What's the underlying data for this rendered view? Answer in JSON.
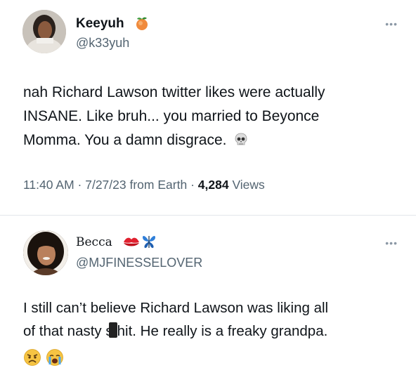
{
  "tweets": [
    {
      "display_name": "Keeyuh",
      "handle": "@k33yuh",
      "text_lines": [
        "nah Richard Lawson twitter likes were actually",
        "INSANE. Like bruh... you married to Beyonce",
        "Momma. You a damn disgrace."
      ],
      "time": "11:40 AM",
      "date": "7/27/23",
      "source": "from Earth",
      "views_count": "4,284",
      "views_label": "Views",
      "name_icon": "peach-icon",
      "trailing_emoji": "skull-icon"
    },
    {
      "display_name": "Becca",
      "handle": "@MJFINESSELOVER",
      "text_line1": "I still can’t believe Richard Lawson was liking all",
      "text_line2_pre": "of that nasty s",
      "text_line2_censored": "hit",
      "text_line2_post": ". He really is a freaky grandpa.",
      "name_icons": [
        "kiss-mark-icon",
        "butterfly-icon"
      ],
      "trailing_emojis": [
        "angry-face-icon",
        "crying-face-icon"
      ]
    }
  ],
  "more_label": "•••",
  "separator": "·",
  "colors": {
    "text": "#0f1419",
    "secondary": "#536471",
    "divider": "#e2e6ea"
  }
}
